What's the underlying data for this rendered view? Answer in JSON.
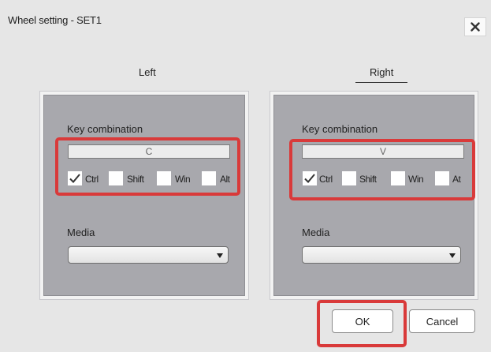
{
  "dialog": {
    "title": "Wheel setting - SET1"
  },
  "tabs": {
    "left": "Left",
    "right": "Right"
  },
  "left_panel": {
    "key_combination_label": "Key combination",
    "key_value": "C",
    "modifiers": [
      {
        "label": "Ctrl",
        "checked": true
      },
      {
        "label": "Shift",
        "checked": false
      },
      {
        "label": "Win",
        "checked": false
      },
      {
        "label": "Alt",
        "checked": false
      }
    ],
    "media_label": "Media",
    "media_value": ""
  },
  "right_panel": {
    "key_combination_label": "Key combination",
    "key_value": "V",
    "modifiers": [
      {
        "label": "Ctrl",
        "checked": true
      },
      {
        "label": "Shift",
        "checked": false
      },
      {
        "label": "Win",
        "checked": false
      },
      {
        "label": "At",
        "checked": false
      }
    ],
    "media_label": "Media",
    "media_value": ""
  },
  "buttons": {
    "ok": "OK",
    "cancel": "Cancel"
  },
  "icons": {
    "close": "close-icon",
    "check": "check-icon",
    "dropdown": "chevron-down-icon"
  },
  "colors": {
    "highlight": "#d93a3a",
    "panel": "#a8a8ad",
    "dialog_bg": "#e6e6e6"
  }
}
